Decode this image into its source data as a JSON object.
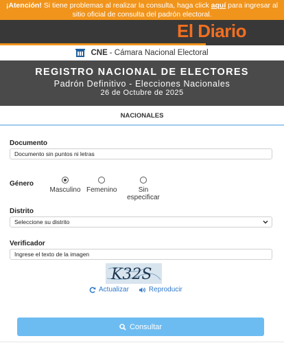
{
  "alert": {
    "prefix": "¡Atención!",
    "text1": " Si tiene problemas al realizar la consulta, haga click ",
    "link": "aquí",
    "text2": " para ingresar al sitio oficial de consulta del padrón electoral."
  },
  "brand": {
    "logo": "El Diario"
  },
  "cne": {
    "abbr": "CNE",
    "name": "- Cámara Nacional Electoral"
  },
  "hero": {
    "title": "REGISTRO NACIONAL DE ELECTORES",
    "subtitle": "Padrón Definitivo - Elecciones Nacionales",
    "date": "26 de Octubre de 2025"
  },
  "tab": {
    "label": "NACIONALES"
  },
  "form": {
    "documento": {
      "label": "Documento",
      "placeholder": "Documento sin puntos ni letras"
    },
    "genero": {
      "label": "Género",
      "options": [
        "Masculino",
        "Femenino",
        "Sin especificar"
      ],
      "selected": "Masculino"
    },
    "distrito": {
      "label": "Distrito",
      "selected": "Seleccione su distrito"
    },
    "verificador": {
      "label": "Verificador",
      "placeholder": "Ingrese el texto de la imagen",
      "captcha_text": "K32S"
    },
    "actions": {
      "refresh": "Actualizar",
      "play": "Reproducir"
    },
    "submit": "Consultar"
  },
  "colors": {
    "alert_bg": "#f1941b",
    "brand_bg": "#383838",
    "logo": "#f26f21",
    "hero_bg": "#4a4a4a",
    "link": "#2f79c9",
    "button": "#6dbcf1"
  },
  "icons": [
    "cne-building-icon",
    "chevron-down-icon",
    "refresh-icon",
    "speaker-icon",
    "search-icon"
  ]
}
